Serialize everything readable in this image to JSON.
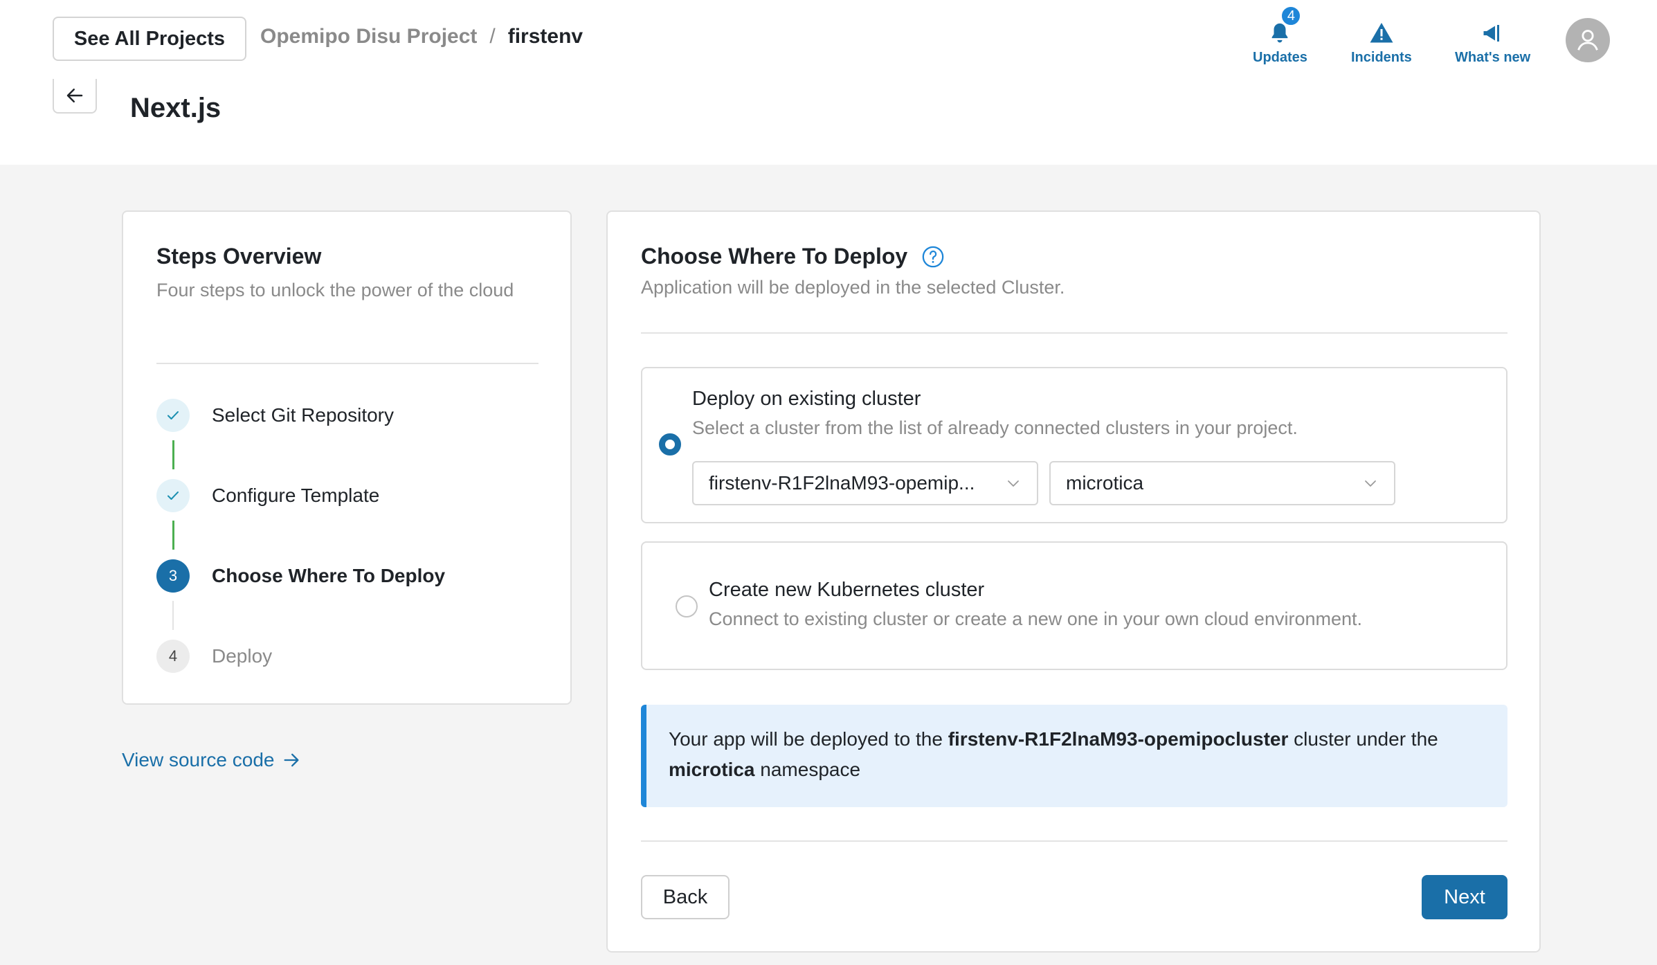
{
  "header": {
    "see_all_label": "See All Projects",
    "project": "Opemipo Disu Project",
    "separator": "/",
    "environment": "firstenv",
    "page_title": "Next.js",
    "actions": {
      "updates": {
        "label": "Updates",
        "badge": "4"
      },
      "incidents": {
        "label": "Incidents"
      },
      "whats_new": {
        "label": "What's new"
      }
    }
  },
  "steps": {
    "title": "Steps Overview",
    "subtitle": "Four steps to unlock the power of the cloud",
    "items": [
      {
        "label": "Select Git Repository",
        "state": "done",
        "marker": ""
      },
      {
        "label": "Configure Template",
        "state": "done",
        "marker": ""
      },
      {
        "label": "Choose Where To Deploy",
        "state": "active",
        "marker": "3"
      },
      {
        "label": "Deploy",
        "state": "todo",
        "marker": "4"
      }
    ],
    "view_source": "View source code"
  },
  "deploy": {
    "title": "Choose Where To Deploy",
    "subtitle": "Application will be deployed in the selected Cluster.",
    "existing": {
      "title": "Deploy on existing cluster",
      "description": "Select a cluster from the list of already connected clusters in your project.",
      "selected": true,
      "cluster_value": "firstenv-R1F2lnaM93-opemip...",
      "namespace_value": "microtica"
    },
    "new_cluster": {
      "title": "Create new Kubernetes cluster",
      "description": "Connect to existing cluster or create a new one in your own cloud environment.",
      "selected": false
    },
    "info": {
      "prefix": "Your app will be deployed to the ",
      "cluster": "firstenv-R1F2lnaM93-opemipocluster",
      "middle": " cluster under the ",
      "namespace": "microtica",
      "suffix": " namespace"
    },
    "back_label": "Back",
    "next_label": "Next"
  },
  "colors": {
    "accent": "#1a6fa8",
    "badge": "#1e86d8",
    "done_line": "#4caf50",
    "info_bg": "#e6f1fc"
  }
}
